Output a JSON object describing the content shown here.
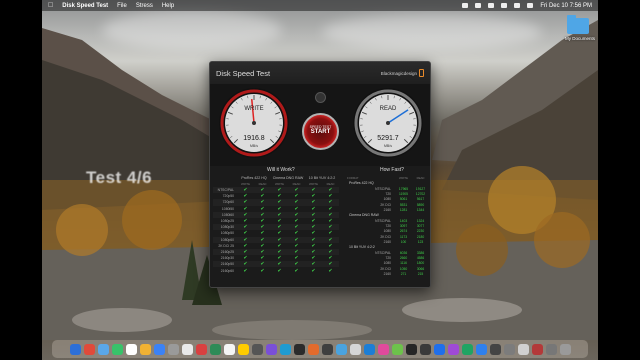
{
  "menubar": {
    "app_name": "Disk Speed Test",
    "menus": [
      "File",
      "Stress",
      "Help"
    ],
    "clock": "Fri Dec 10  7:56 PM"
  },
  "desktop": {
    "folder_label": "My Documents",
    "overlay_text": "Test 4/6"
  },
  "window": {
    "title": "Disk Speed Test",
    "brand": "Blackmagicdesign",
    "write": {
      "label": "WRITE",
      "value": "1916.8",
      "unit": "MB/s",
      "level": 0.48
    },
    "read": {
      "label": "READ",
      "value": "5291.7",
      "unit": "MB/s",
      "level": 0.71
    },
    "start": {
      "top": "SPEED TEST",
      "bottom": "START"
    }
  },
  "will_it_work": {
    "title": "Will it Work?",
    "groups": [
      "ProRes 422 HQ",
      "Cinema DNG RAW",
      "10 Bit YUV 4:2:2"
    ],
    "sub_labels": [
      "WRITE",
      "READ"
    ],
    "rows": [
      "NTSC/PAL",
      "720p50",
      "720p60",
      "1080i50",
      "1080i60",
      "1080p25",
      "1080p30",
      "1080p50",
      "1080p60",
      "2K DCI 25",
      "2160p25",
      "2160p30",
      "2160p50",
      "2160p60"
    ],
    "check": "✔"
  },
  "how_fast": {
    "title": "How Fast?",
    "headers": {
      "format": "FORMAT",
      "write": "WRITE",
      "read": "READ"
    },
    "groups": [
      {
        "name": "ProRes 422 HQ",
        "rows": [
          {
            "res": "NTSC/PAL",
            "w": "17965",
            "r": "19127"
          },
          {
            "res": "720",
            "w": "11905",
            "r": "12702"
          },
          {
            "res": "1080",
            "w": "5061",
            "r": "5617"
          },
          {
            "res": "2K DCI",
            "w": "5531",
            "r": "5890"
          },
          {
            "res": "2160",
            "w": "1281",
            "r": "1344"
          }
        ]
      },
      {
        "name": "Cinema DNG RAW",
        "rows": [
          {
            "res": "NTSC/PAL",
            "w": "1403",
            "r": "1324"
          },
          {
            "res": "720",
            "w": "3097",
            "r": "3077"
          },
          {
            "res": "1080",
            "w": "2674",
            "r": "2230"
          },
          {
            "res": "2K DCI",
            "w": "1173",
            "r": "2180"
          },
          {
            "res": "2160",
            "w": "100",
            "r": "123"
          }
        ]
      },
      {
        "name": "10 Bit YUV 4:2:2",
        "rows": [
          {
            "res": "NTSC/PAL",
            "w": "6036",
            "r": "3386"
          },
          {
            "res": "720",
            "w": "2660",
            "r": "4586"
          },
          {
            "res": "1080",
            "w": "1116",
            "r": "1800"
          },
          {
            "res": "2K DCI",
            "w": "1050",
            "r": "3066"
          },
          {
            "res": "2160",
            "w": "271",
            "r": "215"
          }
        ]
      }
    ]
  },
  "dock": {
    "icon_colors": [
      "#2d6fd8",
      "#e04a3a",
      "#5aa7e8",
      "#38c36a",
      "#ffffff",
      "#f2b233",
      "#3b82f6",
      "#9a9a9a",
      "#e9e9e9",
      "#d94040",
      "#2e8b57",
      "#f5f5f5",
      "#ffcc00",
      "#555555",
      "#7a4fd8",
      "#1f9bd1",
      "#2b2b2b",
      "#e36b2c",
      "#3f3f3f",
      "#4aa3df",
      "#d6d6d6",
      "#1c7ed6",
      "#e04a9c",
      "#6dc24b",
      "#262626",
      "#3a3a3a",
      "#1f6feb",
      "#9f4ad6",
      "#1fa463",
      "#2f80ed",
      "#444444",
      "#7c7c7c",
      "#d0d0d0",
      "#b33939",
      "#777777",
      "#9a9a9a"
    ]
  }
}
